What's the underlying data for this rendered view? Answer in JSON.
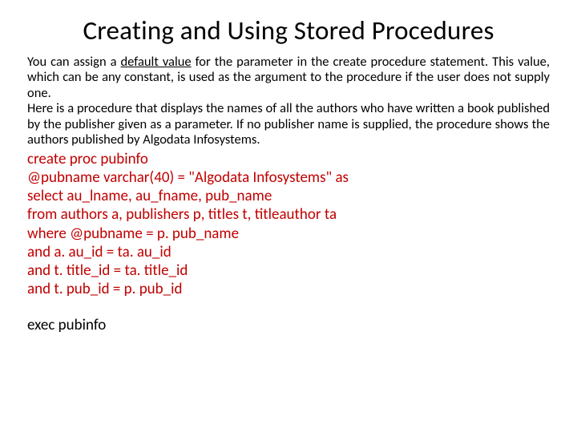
{
  "title": "Creating and Using Stored Procedures",
  "para": {
    "p1a": "You can assign a ",
    "p1u": "default value",
    "p1b": " for the parameter in the create procedure statement. This value, which can be any constant, is used as the argument to the procedure if the user does not supply one.",
    "p2": "Here is a procedure that displays the names of all the authors who have written a book published by the publisher given as a parameter. If no publisher name is supplied, the procedure shows the authors published by Algodata Infosystems."
  },
  "code": {
    "l1": "create proc pubinfo",
    "l2": "@pubname varchar(40) = \"Algodata Infosystems\" as",
    "l3": "select au_lname, au_fname, pub_name",
    "l4": "from authors a, publishers p, titles t, titleauthor ta",
    "l5": "where @pubname = p. pub_name",
    "l6": "and a. au_id = ta. au_id",
    "l7": "and t. title_id = ta. title_id",
    "l8": "and t. pub_id = p. pub_id"
  },
  "exec": "exec pubinfo"
}
